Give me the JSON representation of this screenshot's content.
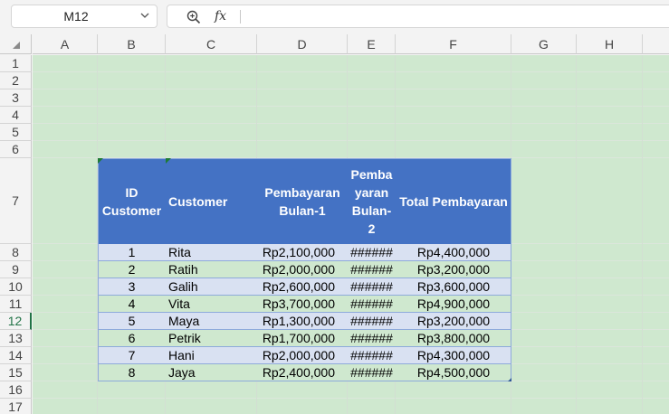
{
  "formula_bar": {
    "name_box": "M12",
    "fx_label": "fx",
    "formula": ""
  },
  "columns": [
    "A",
    "B",
    "C",
    "D",
    "E",
    "F",
    "G",
    "H"
  ],
  "rows": [
    "1",
    "2",
    "3",
    "4",
    "5",
    "6",
    "7",
    "8",
    "9",
    "10",
    "11",
    "12",
    "13",
    "14",
    "15",
    "16",
    "17"
  ],
  "active_row": "12",
  "table": {
    "headers": {
      "id": "ID Customer",
      "customer": "Customer",
      "bulan1": "Pembayaran Bulan-1",
      "bulan2": "Pemba yaran Bulan- 2",
      "total": "Total Pembayaran"
    },
    "rows": [
      {
        "id": "1",
        "customer": "Rita",
        "bulan1": "Rp2,100,000",
        "bulan2": "######",
        "total": "Rp4,400,000"
      },
      {
        "id": "2",
        "customer": "Ratih",
        "bulan1": "Rp2,000,000",
        "bulan2": "######",
        "total": "Rp3,200,000"
      },
      {
        "id": "3",
        "customer": "Galih",
        "bulan1": "Rp2,600,000",
        "bulan2": "######",
        "total": "Rp3,600,000"
      },
      {
        "id": "4",
        "customer": "Vita",
        "bulan1": "Rp3,700,000",
        "bulan2": "######",
        "total": "Rp4,900,000"
      },
      {
        "id": "5",
        "customer": "Maya",
        "bulan1": "Rp1,300,000",
        "bulan2": "######",
        "total": "Rp3,200,000"
      },
      {
        "id": "6",
        "customer": "Petrik",
        "bulan1": "Rp1,700,000",
        "bulan2": "######",
        "total": "Rp3,800,000"
      },
      {
        "id": "7",
        "customer": "Hani",
        "bulan1": "Rp2,000,000",
        "bulan2": "######",
        "total": "Rp4,300,000"
      },
      {
        "id": "8",
        "customer": "Jaya",
        "bulan1": "Rp2,400,000",
        "bulan2": "######",
        "total": "Rp4,500,000"
      }
    ]
  },
  "colors": {
    "header_fill": "#4472c4",
    "band_fill": "#d9e1f2",
    "sheet_fill": "#cfe8cf",
    "accent": "#217346"
  }
}
